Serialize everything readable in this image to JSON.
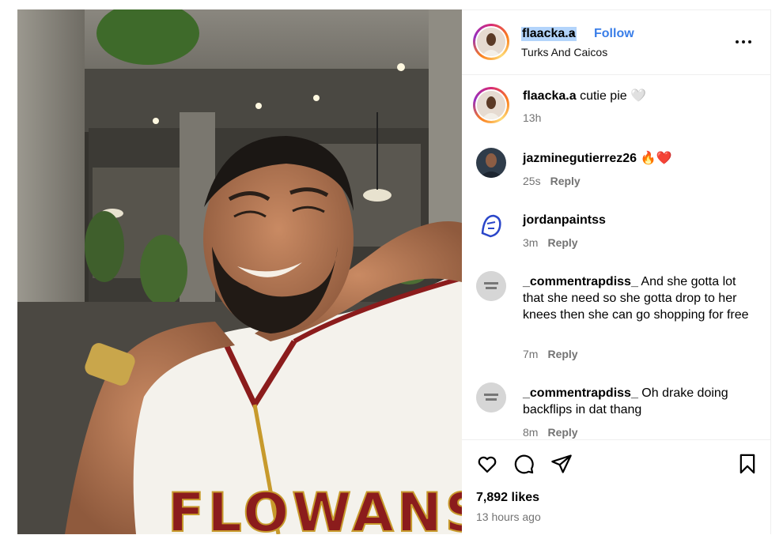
{
  "post": {
    "username": "flaacka.a",
    "separator": "•",
    "follow_label": "Follow",
    "location": "Turks And Caicos",
    "caption_username": "flaacka.a",
    "caption_text": "cutie pie 🤍",
    "caption_time": "13h",
    "likes": "7,892 likes",
    "time_ago": "13 hours ago",
    "jersey_text": "FLOWANS"
  },
  "comments": [
    {
      "username": "jazminegutierrez26",
      "text": "🔥❤️",
      "time": "25s",
      "reply": "Reply"
    },
    {
      "username": "jordanpaintss",
      "text": "",
      "time": "3m",
      "reply": "Reply"
    },
    {
      "username": "_commentrapdiss_",
      "text": "And she gotta lot that she need so she gotta drop to her knees then she can go shopping for free",
      "time": "7m",
      "reply": "Reply"
    },
    {
      "username": "_commentrapdiss_",
      "text": "Oh drake doing backflips in dat thang",
      "time": "8m",
      "reply": "Reply"
    }
  ],
  "icons": {
    "more": "more-options-icon",
    "like": "heart-icon",
    "comment": "comment-bubble-icon",
    "share": "paper-plane-icon",
    "save": "bookmark-icon"
  },
  "colors": {
    "follow": "#3a7ee8",
    "meta": "#737373",
    "selection": "#b3d4fb"
  }
}
